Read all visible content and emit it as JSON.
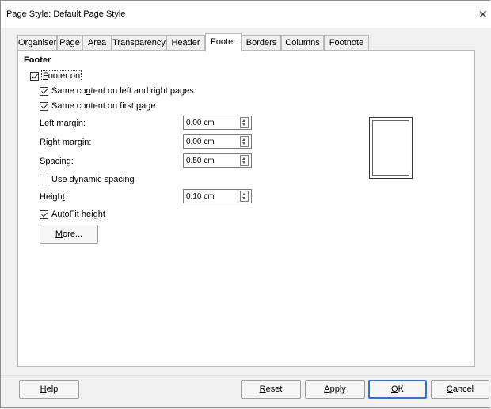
{
  "window": {
    "title": "Page Style: Default Page Style",
    "close_glyph": "✕"
  },
  "tabs": [
    {
      "label": "Organiser",
      "active": false
    },
    {
      "label": "Page",
      "active": false
    },
    {
      "label": "Area",
      "active": false
    },
    {
      "label": "Transparency",
      "active": false
    },
    {
      "label": "Header",
      "active": false
    },
    {
      "label": "Footer",
      "active": true
    },
    {
      "label": "Borders",
      "active": false
    },
    {
      "label": "Columns",
      "active": false
    },
    {
      "label": "Footnote",
      "active": false
    }
  ],
  "footer": {
    "section_title": "Footer",
    "footer_on": {
      "label_pre": "",
      "label_u": "F",
      "label_post": "ooter on",
      "checked": true
    },
    "same_left_right": {
      "label_pre": "Same co",
      "label_u": "n",
      "label_post": "tent on left and right pages",
      "checked": true
    },
    "same_first": {
      "label_pre": "Same content on first ",
      "label_u": "p",
      "label_post": "age",
      "checked": true
    },
    "left_margin": {
      "label_pre": "",
      "label_u": "L",
      "label_post": "eft margin:",
      "value": "0.00 cm"
    },
    "right_margin": {
      "label_pre": "R",
      "label_u": "i",
      "label_post": "ght margin:",
      "value": "0.00 cm"
    },
    "spacing": {
      "label_pre": "",
      "label_u": "S",
      "label_post": "pacing:",
      "value": "0.50 cm"
    },
    "dynamic_spacing": {
      "label_pre": "Use d",
      "label_u": "y",
      "label_post": "namic spacing",
      "checked": false
    },
    "height": {
      "label_pre": "Heigh",
      "label_u": "t",
      "label_post": ":",
      "value": "0.10 cm"
    },
    "autofit": {
      "label_pre": "",
      "label_u": "A",
      "label_post": "utoFit height",
      "checked": true
    },
    "more_button": {
      "label_pre": "",
      "label_u": "M",
      "label_post": "ore..."
    }
  },
  "buttons": {
    "help": {
      "label_pre": "",
      "label_u": "H",
      "label_post": "elp"
    },
    "reset": {
      "label_pre": "",
      "label_u": "R",
      "label_post": "eset"
    },
    "apply": {
      "label_pre": "",
      "label_u": "A",
      "label_post": "pply"
    },
    "ok": {
      "label_pre": "",
      "label_u": "O",
      "label_post": "K"
    },
    "cancel": {
      "label_pre": "",
      "label_u": "C",
      "label_post": "ancel"
    }
  },
  "colors": {
    "default_button_border": "#2f72d8",
    "panel_background": "#ffffff",
    "dialog_background": "#f0f0f0"
  }
}
